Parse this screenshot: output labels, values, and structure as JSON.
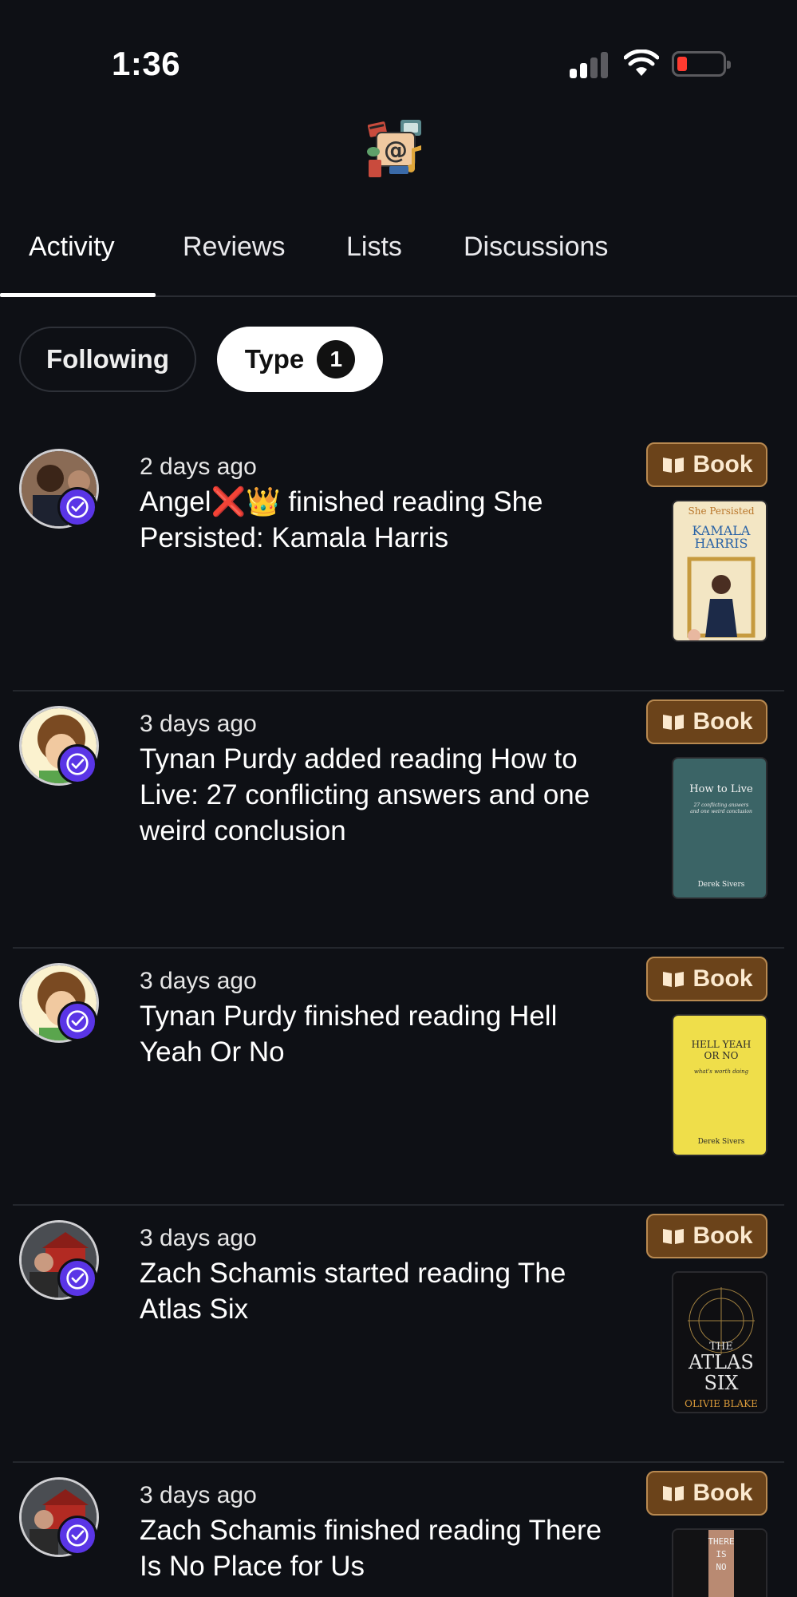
{
  "status_bar": {
    "time": "1:36"
  },
  "tabs": [
    {
      "label": "Activity",
      "active": true
    },
    {
      "label": "Reviews",
      "active": false
    },
    {
      "label": "Lists",
      "active": false
    },
    {
      "label": "Discussions",
      "active": false
    }
  ],
  "filters": {
    "following_label": "Following",
    "type_label": "Type",
    "type_count": "1"
  },
  "feed": [
    {
      "timestamp": "2 days ago",
      "text": "Angel❌👑 finished reading She Persisted: Kamala Harris",
      "badge": "Book"
    },
    {
      "timestamp": "3 days ago",
      "text": "Tynan Purdy added reading How to Live: 27 conflicting answers and one weird conclusion",
      "badge": "Book"
    },
    {
      "timestamp": "3 days ago",
      "text": "Tynan Purdy finished reading Hell Yeah Or No",
      "badge": "Book"
    },
    {
      "timestamp": "3 days ago",
      "text": "Zach Schamis started reading The Atlas Six",
      "badge": "Book"
    },
    {
      "timestamp": "3 days ago",
      "text": "Zach Schamis finished reading There Is No Place for Us",
      "badge": "Book"
    }
  ],
  "covers": {
    "she_persisted": {
      "title_top": "She Persisted",
      "title_main": "KAMALA HARRIS"
    },
    "how_to_live": {
      "title": "How to Live",
      "subtitle": "27 conflicting answers and one weird conclusion",
      "author": "Derek Sivers"
    },
    "hell_yeah": {
      "title": "Hell Yeah or No",
      "subtitle": "what's worth doing",
      "author": "Derek Sivers"
    },
    "atlas_six": {
      "title": "THE ATLAS SIX",
      "author": "OLIVIE BLAKE"
    },
    "no_place": {
      "title": "THERE IS NO"
    }
  },
  "colors": {
    "background": "#0e1015",
    "badge_bg": "#6b431a",
    "badge_border": "#b88950",
    "verified_badge": "#5a35e6",
    "battery_low": "#ff3b30"
  }
}
